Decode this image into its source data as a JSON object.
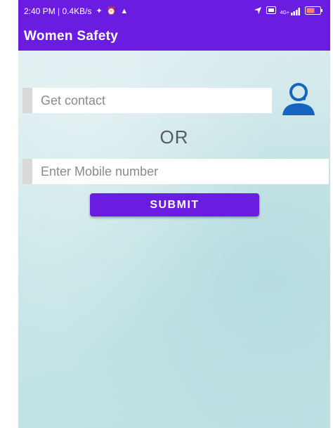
{
  "status_bar": {
    "left_text": "2:40 PM | 0.4KB/s",
    "left_icons": [
      "signal-app-icon",
      "alarm-icon",
      "notification-icon"
    ],
    "right_icons": [
      "location-icon",
      "sim-icon",
      "4g-signal-icon",
      "battery-icon"
    ],
    "network_label": "4G+"
  },
  "app_bar": {
    "title": "Women Safety"
  },
  "contact": {
    "placeholder": "Get contact",
    "icon": "contact-person-icon"
  },
  "divider_text": "OR",
  "mobile": {
    "placeholder": "Enter Mobile number"
  },
  "submit": {
    "label": "SUBMIT"
  },
  "colors": {
    "primary": "#6a1de0",
    "background": "#cfe7e9",
    "icon_blue": "#1565c0"
  }
}
